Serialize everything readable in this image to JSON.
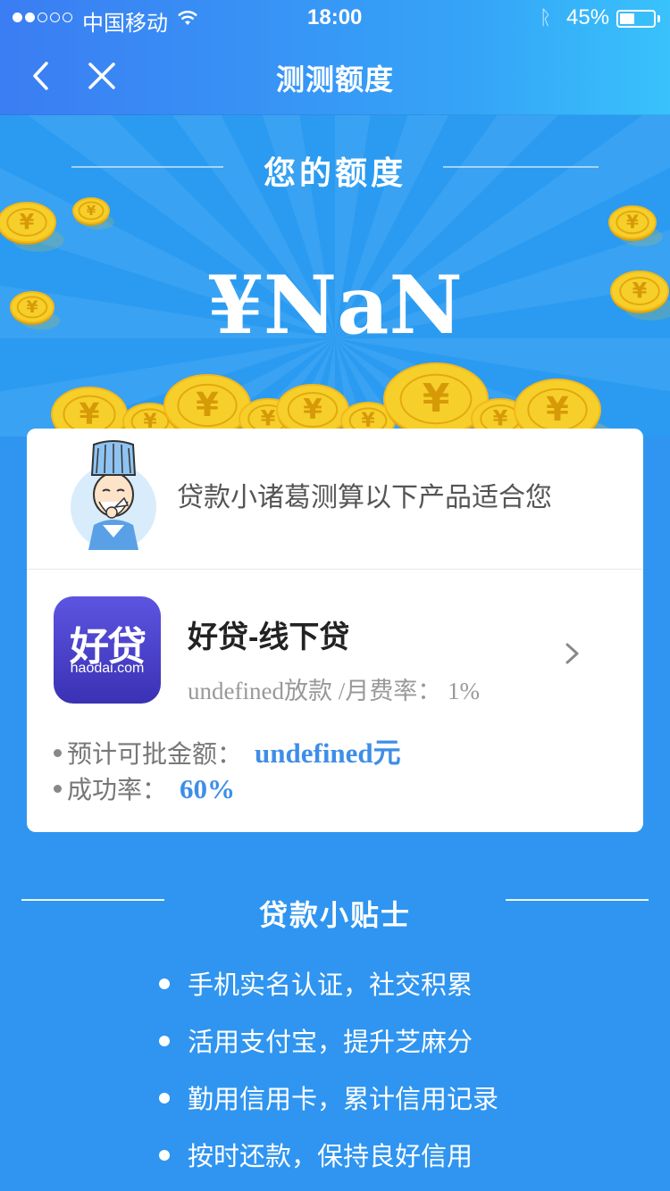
{
  "status_bar": {
    "signal_dots_filled": 2,
    "signal_dots_total": 5,
    "carrier": "中国移动",
    "time": "18:00",
    "battery_pct_text": "45%",
    "battery_level": 0.45
  },
  "nav": {
    "back_icon": "chevron-left-icon",
    "close_icon": "close-icon",
    "title": "测测额度"
  },
  "hero": {
    "heading": "您的额度",
    "amount": "¥NaN"
  },
  "card": {
    "intro": "贷款小诸葛测算以下产品适合您",
    "product": {
      "logo_main": "好贷",
      "logo_sub": "haodai.com",
      "name": "好贷-线下贷",
      "meta": "undefined放款 /月费率： 1%",
      "approve_label": "预计可批金额：",
      "approve_value": "undefined元",
      "success_label": "成功率：",
      "success_value": "60%"
    }
  },
  "tips": {
    "title": "贷款小贴士",
    "items": [
      "手机实名认证，社交积累",
      "活用支付宝，提升芝麻分",
      "勤用信用卡，累计信用记录",
      "按时还款，保持良好信用"
    ]
  },
  "colors": {
    "primary_blue": "#2f95f0",
    "nav_gradient_start": "#3b7df3",
    "nav_gradient_end": "#39c2fb",
    "highlight_blue": "#3e8ee8",
    "coin_gold": "#f5c518",
    "logo_purple": "#4a41c8"
  }
}
